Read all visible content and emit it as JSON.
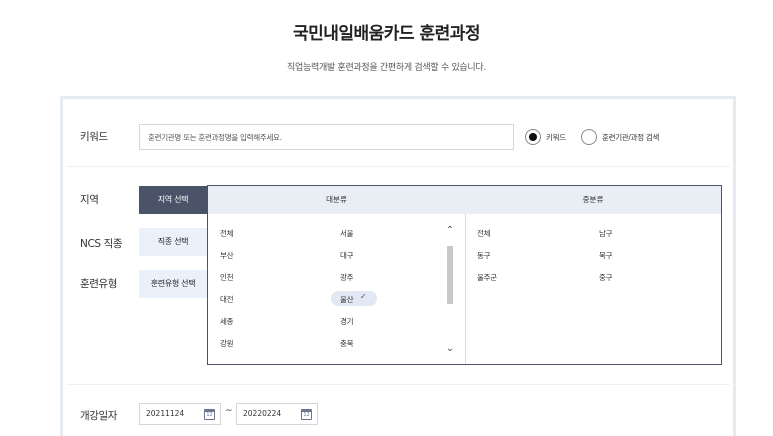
{
  "header": {
    "title": "국민내일배움카드 훈련과정",
    "subtitle": "직업능력개발 훈련과정을 간편하게 검색할 수 있습니다."
  },
  "keyword": {
    "label": "키워드",
    "placeholder": "훈련기관명 또는 훈련과정명을 입력해주세요.",
    "value": ""
  },
  "search_mode": {
    "options": [
      {
        "label": "키워드",
        "selected": true
      },
      {
        "label": "훈련기관/과정 검색",
        "selected": false
      }
    ]
  },
  "filters": {
    "region": {
      "label": "지역",
      "button": "지역 선택",
      "active": true
    },
    "ncs": {
      "label": "NCS 직종",
      "button": "직종 선택",
      "active": false
    },
    "training_type": {
      "label": "훈련유형",
      "button": "훈련유형 선택",
      "active": false
    }
  },
  "region_picker": {
    "major_header": "대분류",
    "minor_header": "중분류",
    "major_rows": [
      [
        "전체",
        "서울"
      ],
      [
        "부산",
        "대구"
      ],
      [
        "인천",
        "광주"
      ],
      [
        "대전",
        "울산"
      ],
      [
        "세종",
        "경기"
      ],
      [
        "강원",
        "충북"
      ]
    ],
    "selected_major": "울산",
    "minor_rows": [
      [
        "전체",
        "남구"
      ],
      [
        "동구",
        "북구"
      ],
      [
        "울주군",
        "중구"
      ]
    ]
  },
  "period": {
    "label": "개강일자",
    "start": "20211124",
    "end": "20220224",
    "separator": "~"
  },
  "icons": {
    "calendar": "calendar-icon",
    "check": "check-icon",
    "scroll_up": "chevron-up-icon",
    "scroll_down": "chevron-down-icon"
  },
  "colors": {
    "active_button": "#4a5368",
    "inactive_button": "#eaf1fb",
    "panel_border": "#e6ebf3",
    "selected_pill": "#e3e8f5"
  }
}
